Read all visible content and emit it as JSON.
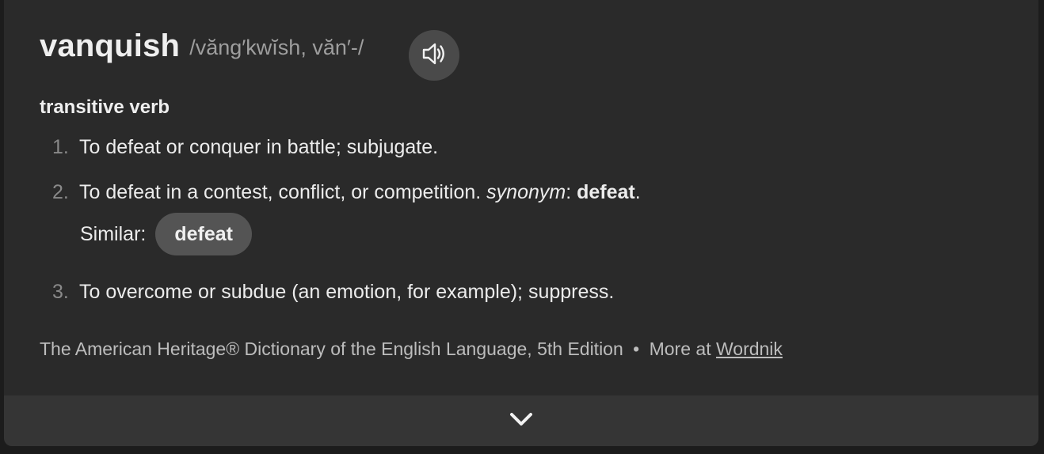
{
  "entry": {
    "headword": "vanquish",
    "pronunciation": "/văng′kwĭsh, văn′-/",
    "audio_icon": "speaker-icon",
    "part_of_speech": "transitive verb"
  },
  "senses": [
    {
      "num": "1.",
      "text": "To defeat or conquer in battle; subjugate."
    },
    {
      "num": "2.",
      "text": "To defeat in a contest, conflict, or competition. ",
      "synonym_label": "synonym",
      "synonym_sep": ": ",
      "synonym_word": "defeat",
      "synonym_end": "."
    },
    {
      "num": "3.",
      "text": "To overcome or subdue (an emotion, for example); suppress."
    }
  ],
  "similar": {
    "label": "Similar:",
    "chips": [
      "defeat"
    ]
  },
  "source": {
    "text": "The American Heritage® Dictionary of the English Language, 5th Edition",
    "dot": "•",
    "more_prefix": "More at ",
    "link": "Wordnik"
  },
  "footer": {
    "expand_icon": "chevron-down-icon"
  }
}
